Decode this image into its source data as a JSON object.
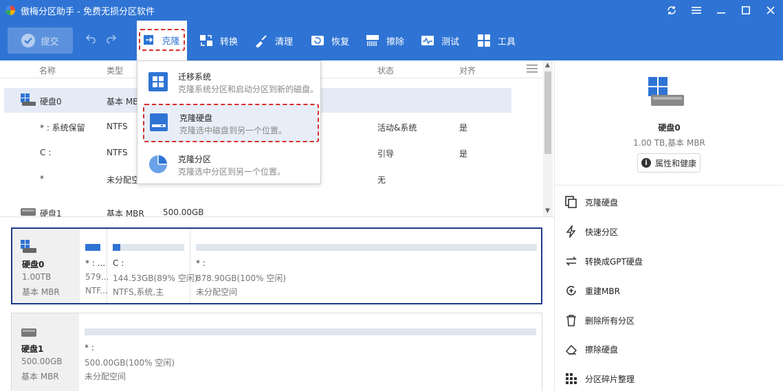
{
  "app": {
    "title": "傲梅分区助手 - 免费无损分区软件"
  },
  "toolbar": {
    "submit": "提交",
    "clone": "克隆",
    "convert": "转换",
    "clean": "清理",
    "restore": "恢复",
    "wipe": "擦除",
    "test": "测试",
    "tools": "工具"
  },
  "table": {
    "columns": {
      "name": "名称",
      "type": "类型",
      "status": "状态",
      "align": "对齐"
    },
    "rows": [
      {
        "name": "硬盘0",
        "type": "基本 MBR",
        "status": "",
        "align": ""
      },
      {
        "name": "* : 系统保留",
        "type": "NTFS",
        "status": "活动&系统",
        "align": "是"
      },
      {
        "name": "C :",
        "type": "NTFS",
        "status": "引导",
        "align": "是"
      },
      {
        "name": "*",
        "type": "未分配空间",
        "status": "无",
        "align": ""
      },
      {
        "name": "硬盘1",
        "type": "基本 MBR",
        "size": "500.00GB",
        "status": "",
        "align": ""
      }
    ]
  },
  "dropdown": {
    "items": [
      {
        "title": "迁移系统",
        "desc": "克隆系统分区和启动分区到新的磁盘。"
      },
      {
        "title": "克隆硬盘",
        "desc": "克隆选中磁盘到另一个位置。"
      },
      {
        "title": "克隆分区",
        "desc": "克隆选中分区到另一个位置。"
      }
    ]
  },
  "disks": [
    {
      "name": "硬盘0",
      "size": "1.00TB",
      "type": "基本 MBR",
      "partitions": [
        {
          "label": "* : ...",
          "line1": "579...",
          "line2": "NTF...",
          "fill": 1.0
        },
        {
          "label": "C :",
          "line1": "144.53GB(89% 空闲)",
          "line2": "NTFS,系统,主",
          "fill": 0.11
        },
        {
          "label": "* :",
          "line1": "878.90GB(100% 空闲)",
          "line2": "未分配空间",
          "fill": 0
        }
      ]
    },
    {
      "name": "硬盘1",
      "size": "500.00GB",
      "type": "基本 MBR",
      "partitions": [
        {
          "label": "* :",
          "line1": "500.00GB(100% 空闲)",
          "line2": "未分配空间",
          "fill": 0
        }
      ]
    }
  ],
  "right_panel": {
    "disk_name": "硬盘0",
    "disk_info": "1.00 TB,基本 MBR",
    "properties": "属性和健康",
    "operations": [
      "克隆硬盘",
      "快速分区",
      "转换成GPT硬盘",
      "重建MBR",
      "删除所有分区",
      "擦除硬盘",
      "分区碎片整理"
    ]
  },
  "colors": {
    "accent": "#2f74d4",
    "highlight": "#d92b2b",
    "selected_border": "#1e3a8a"
  }
}
